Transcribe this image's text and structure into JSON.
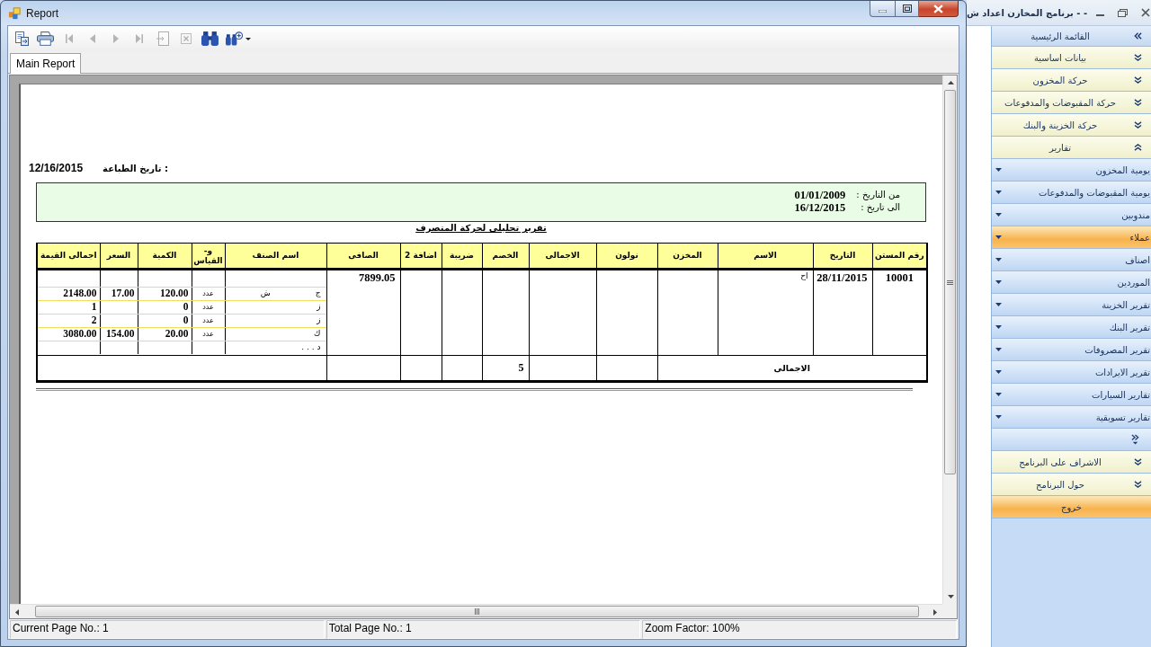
{
  "report_window": {
    "title": "Report",
    "toolbar": [
      {
        "kind": "export",
        "disabled": false
      },
      {
        "kind": "print",
        "disabled": false
      },
      {
        "kind": "first",
        "disabled": true
      },
      {
        "kind": "previous",
        "disabled": true
      },
      {
        "kind": "next",
        "disabled": true
      },
      {
        "kind": "last",
        "disabled": true
      },
      {
        "kind": "goto",
        "disabled": true
      },
      {
        "kind": "close",
        "disabled": true
      },
      {
        "kind": "search",
        "disabled": false
      },
      {
        "kind": "zoom",
        "disabled": false
      }
    ],
    "tabs": [
      {
        "label": "Main Report",
        "selected": true
      }
    ],
    "report": {
      "print_date": {
        "label": "تاريخ الطباعة :",
        "value": "12/16/2015"
      },
      "date_range": [
        {
          "label": "من التاريخ :",
          "value": "01/01/2009"
        },
        {
          "label": "الى تاريخ :",
          "value": "16/12/2015"
        }
      ],
      "title": "تقرير تحليلى لحركة المتصرف",
      "table": {
        "columns": [
          "رقم المستن",
          "التاريخ",
          "الاسم",
          "المخزن",
          "نولون",
          "الاجمالى",
          "الخصم",
          "ضريبة",
          "اضافة 2",
          "الصافى",
          "اسم الصنف",
          "و- القياس",
          "الكمية",
          "السعر",
          "اجمالى القيمة"
        ],
        "rows": [
          {
            "document_no": "10001",
            "date": "28/11/2015",
            "name": "اح",
            "net": "7899.05",
            "items": [
              {
                "name_parts": [
                  "ج",
                  "ش"
                ],
                "unit": "عدد",
                "quantity": "120.00",
                "price": "17.00",
                "total_value": "2148.00"
              },
              {
                "name_parts": [
                  "ز"
                ],
                "unit": "عدد",
                "quantity": "0",
                "total_value": "1"
              },
              {
                "name_parts": [
                  "ز"
                ],
                "unit": "عدد",
                "quantity": "0",
                "total_value": "2"
              },
              {
                "name_parts": [
                  "ك"
                ],
                "unit": "عدد",
                "quantity": "20.00",
                "price": "154.00",
                "total_value": "3080.00"
              },
              {
                "name_parts": [
                  "د . . ."
                ]
              }
            ]
          }
        ],
        "totals": {
          "label": "الاجمالى",
          "discount": "5"
        }
      }
    },
    "status_bar": {
      "current_page": "Current Page No.: 1",
      "total_pages": "Total Page No.: 1",
      "zoom_factor": "Zoom Factor: 100%"
    }
  },
  "main_window": {
    "title": "- - برنامج المخازن اعداد ش",
    "sidebar": {
      "items": [
        {
          "kind": "title",
          "label": "القائمة الرئيسية"
        },
        {
          "kind": "group",
          "label": "بيانات اساسية",
          "expanded": false
        },
        {
          "kind": "group",
          "label": "حركة المخزون",
          "expanded": false
        },
        {
          "kind": "group",
          "label": "حركة المقبوضات والمدفوعات",
          "expanded": false
        },
        {
          "kind": "group",
          "label": "حركة الخزينة والبنك",
          "expanded": false
        },
        {
          "kind": "group",
          "label": "تقارير",
          "expanded": true,
          "children": [
            {
              "label": "يومية المخزون",
              "selected": false
            },
            {
              "label": "يومية المقبوضات والمدفوعات",
              "selected": false
            },
            {
              "label": "مندوبين",
              "selected": false
            },
            {
              "label": "عملاء",
              "selected": true
            },
            {
              "label": "اصناف",
              "selected": false
            },
            {
              "label": "الموردين",
              "selected": false
            },
            {
              "label": "تقرير الخزينة",
              "selected": false
            },
            {
              "label": "تقرير البنك",
              "selected": false
            },
            {
              "label": "تقرير المصروفات",
              "selected": false
            },
            {
              "label": "تقرير الايرادات",
              "selected": false
            },
            {
              "label": "تقارير السيارات",
              "selected": false
            },
            {
              "label": "تقارير تسويقية",
              "selected": false
            }
          ]
        },
        {
          "kind": "group",
          "label": "الاشراف على البرنامج",
          "expanded": false
        },
        {
          "kind": "group",
          "label": "حول البرنامج",
          "expanded": false
        },
        {
          "kind": "exit",
          "label": "خروج"
        }
      ]
    }
  }
}
